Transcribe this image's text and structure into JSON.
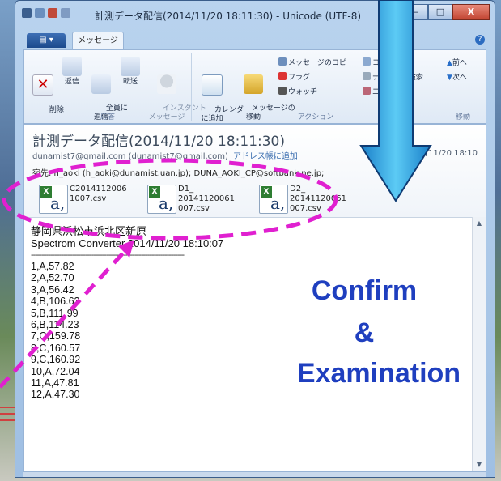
{
  "window": {
    "title": "計測データ配信(2014/11/20 18:11:30) - Unicode (UTF-8)",
    "minimize": "–",
    "maximize": "□",
    "close": "X"
  },
  "tabs": {
    "file": "▤ ▾",
    "message": "メッセージ"
  },
  "ribbon": {
    "reply_group": {
      "label": "応答",
      "delete": "削除",
      "reply": "返信",
      "reply_all": "全員に\n返信",
      "forward": "転送",
      "instant": "インスタント\nメッセージ"
    },
    "action_group": {
      "label": "アクション",
      "calendar": "カレンダー\nに追加",
      "move": "メッセージの\n移動",
      "copy_msg": "メッセージのコピー",
      "flag": "フラグ",
      "watch": "ウォッチ",
      "copy": "コピー",
      "text_search": "テキストの検索",
      "encode": "エンコード"
    },
    "move_group": {
      "label": "移動",
      "prev": "前へ",
      "next": "次へ"
    }
  },
  "message": {
    "subject": "計測データ配信(2014/11/20 18:11:30)",
    "sender": "dunamist7@gmail.com (dunamist7@gmail.com)",
    "add_contact": "アドレス帳に追加",
    "date": "2014/11/20 18:10",
    "to": "宛先: h_aoki (h_aoki@dunamist.uan.jp); DUNA_AOKI_CP@softbank.ne.jp;",
    "attachments": [
      {
        "line1": "C2014112006",
        "line2": "1007.csv",
        "line3": ""
      },
      {
        "line1": "D1_",
        "line2": "20141120061",
        "line3": "007.csv"
      },
      {
        "line1": "D2_",
        "line2": "20141120061",
        "line3": "007.csv"
      }
    ],
    "body_line1": "静岡県浜松市浜北区新原",
    "body_line2": "Spectrom Converter 2014/11/20 18:10:07",
    "body_rule": "-----------------------------------------------------------------------",
    "rows": [
      "1,A,57.82",
      "2,A,52.70",
      "3,A,56.42",
      "4,B,106.63",
      "5,B,111.99",
      "6,B,114.23",
      "7,C,159.78",
      "8,C,160.57",
      "9,C,160.92",
      "10,A,72.04",
      "11,A,47.81",
      "12,A,47.30"
    ]
  },
  "overlay": {
    "line1": "Confirm",
    "line2": "&",
    "line3": "Examination"
  },
  "colors": {
    "annotation_pink": "#e020d0",
    "arrow_blue": "#2aa7e8",
    "overlay_text": "#1f3fbf"
  }
}
